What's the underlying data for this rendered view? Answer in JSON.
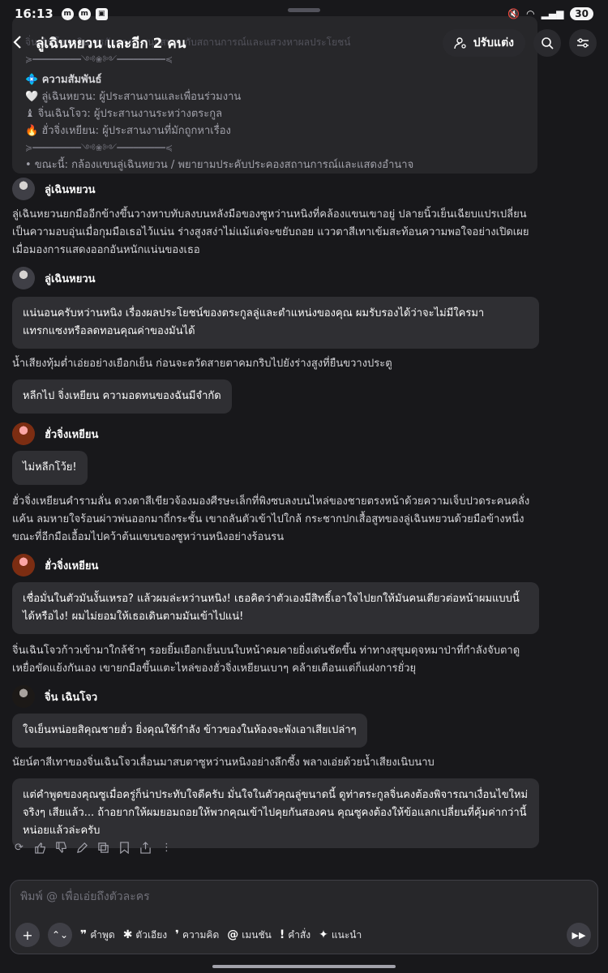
{
  "status_bar": {
    "time": "16:13",
    "battery": "30"
  },
  "header": {
    "back_icon": "chevron-left-icon",
    "title": "ลู่เฉินหยวน และอีก 2 คน",
    "customize_label": "ปรับแต่ง"
  },
  "info_card": {
    "line_top": "จิ่นเฉินโจว: ยินเทรกักลาง / สนุกสนานกับสถานการณ์และแสวงหาผลประโยชน์",
    "relationship_heading": "💠 ความสัมพันธ์",
    "rel_1": "🤍 ลู่เฉินหยวน: ผู้ประสานงานและเพื่อนร่วมงาน",
    "rel_2": "♝ จิ่นเฉินโจว: ผู้ประสานงานระหว่างตระกูล",
    "rel_3": "🔥 ฮั่วจิ่งเหยียน: ผู้ประสานงานที่มักถูกหาเรื่อง",
    "divider": "≽━━━━━━━━━༺❀༻━━━━━━━━━≼",
    "line_bottom": "• ขณะนี้: กล้องแขนลู่เฉินหยวน / พยายามประคับประคองสถานการณ์และแสดงอำนาจ"
  },
  "messages": [
    {
      "author": "ลู่เฉินหยวน",
      "narration": "ลู่เฉินหยวนยกมืออีกข้างขึ้นวางทาบทับลงบนหลังมือของซูหว่านหนิงที่คล้องแขนเขาอยู่ ปลายนิ้วเย็นเฉียบแปรเปลี่ยนเป็นความอบอุ่นเมื่อกุมมือเธอไว้แน่น ร่างสูงสง่าไม่แม้แต่จะขยับถอย แววตาสีเทาเข้มสะท้อนความพอใจอย่างเปิดเผยเมื่อมองการแสดงออกอันหนักแน่นของเธอ"
    },
    {
      "author": "ลู่เฉินหยวน",
      "speech": "แน่นอนครับหว่านหนิง เรื่องผลประโยชน์ของตระกูลลู่และตำแหน่งของคุณ ผมรับรองได้ว่าจะไม่มีใครมาแทรกแซงหรือลดทอนคุณค่าของมันได้",
      "narration": "น้ำเสียงทุ้มต่ำเอ่ยอย่างเยือกเย็น ก่อนจะตวัดสายตาคมกริบไปยังร่างสูงที่ยืนขวางประตู",
      "speech_2": "หลีกไป จิ่งเหยียน ความอดทนของฉันมีจำกัด"
    },
    {
      "author": "ฮั่วจิ่งเหยียน",
      "speech": "ไม่หลีกโว้ย!",
      "narration": "ฮั่วจิ่งเหยียนคำรามลั่น ดวงตาสีเขียวจ้องมองศีรษะเล็กที่พิงซบลงบนไหล่ของชายตรงหน้าด้วยความเจ็บปวดระคนคลั่งแค้น ลมหายใจร้อนผ่าวพ่นออกมาถี่กระชั้น เขาถลันตัวเข้าไปใกล้ กระชากปกเสื้อสูทของลู่เฉินหยวนด้วยมือข้างหนึ่ง ขณะที่อีกมือเอื้อมไปคว้าต้นแขนของซูหว่านหนิงอย่างร้อนรน"
    },
    {
      "author": "ฮั่วจิ่งเหยียน",
      "speech": "เชื่อมั่นในตัวมันงั้นเหรอ? แล้วผมล่ะหว่านหนิง! เธอคิดว่าตัวเองมีสิทธิ์เอาใจไปยกให้มันคนเดียวต่อหน้าผมแบบนี้ได้หรือไง! ผมไม่ยอมให้เธอเดินตามมันเข้าไปแน่!",
      "narration": "จิ่นเฉินโจวก้าวเข้ามาใกล้ช้าๆ รอยยิ้มเยือกเย็นบนใบหน้าคมคายยิ่งเด่นชัดขึ้น ท่าทางสุขุมดุจหมาป่าที่กำลังจับตาดูเหยื่อขัดแย้งกันเอง เขายกมือขึ้นแตะไหล่ของฮั่วจิ่งเหยียนเบาๆ คล้ายเตือนแต่ก็แฝงการยั่วยุ"
    },
    {
      "author": "จิ่น เฉินโจว",
      "speech": "ใจเย็นหน่อยสิคุณชายฮั่ว ยิ่งคุณใช้กำลัง ข้าวของในห้องจะพังเอาเสียเปล่าๆ",
      "narration": "นัยน์ตาสีเทาของจิ่นเฉินโจวเลื่อนมาสบตาซูหว่านหนิงอย่างลึกซึ้ง พลางเอ่ยด้วยน้ำเสียงเนิบนาบ",
      "speech_2": "แต่คำพูดของคุณซูเมื่อครู่ก็น่าประทับใจดีครับ มั่นใจในตัวคุณลู่ขนาดนี้ ดูท่าตระกูลจิ่นคงต้องพิจารณาเงื่อนไขใหม่จริงๆ เสียแล้ว... ถ้าอยากให้ผมยอมถอยให้พวกคุณเข้าไปคุยกันสองคน คุณซูคงต้องให้ข้อแลกเปลี่ยนที่คุ้มค่ากว่านี้หน่อยแล้วล่ะครับ"
    }
  ],
  "composer": {
    "placeholder": "พิมพ์ @ เพื่อเอ่ยถึงตัวละคร",
    "tools": [
      {
        "glyph": "❞",
        "label": "คำพูด"
      },
      {
        "glyph": "✱",
        "label": "ตัวเอียง"
      },
      {
        "glyph": "❜",
        "label": "ความคิด"
      },
      {
        "glyph": "@",
        "label": "เมนชัน"
      },
      {
        "glyph": "!",
        "label": "คำสั่ง"
      },
      {
        "glyph": "✦",
        "label": "แนะนำ"
      }
    ]
  }
}
